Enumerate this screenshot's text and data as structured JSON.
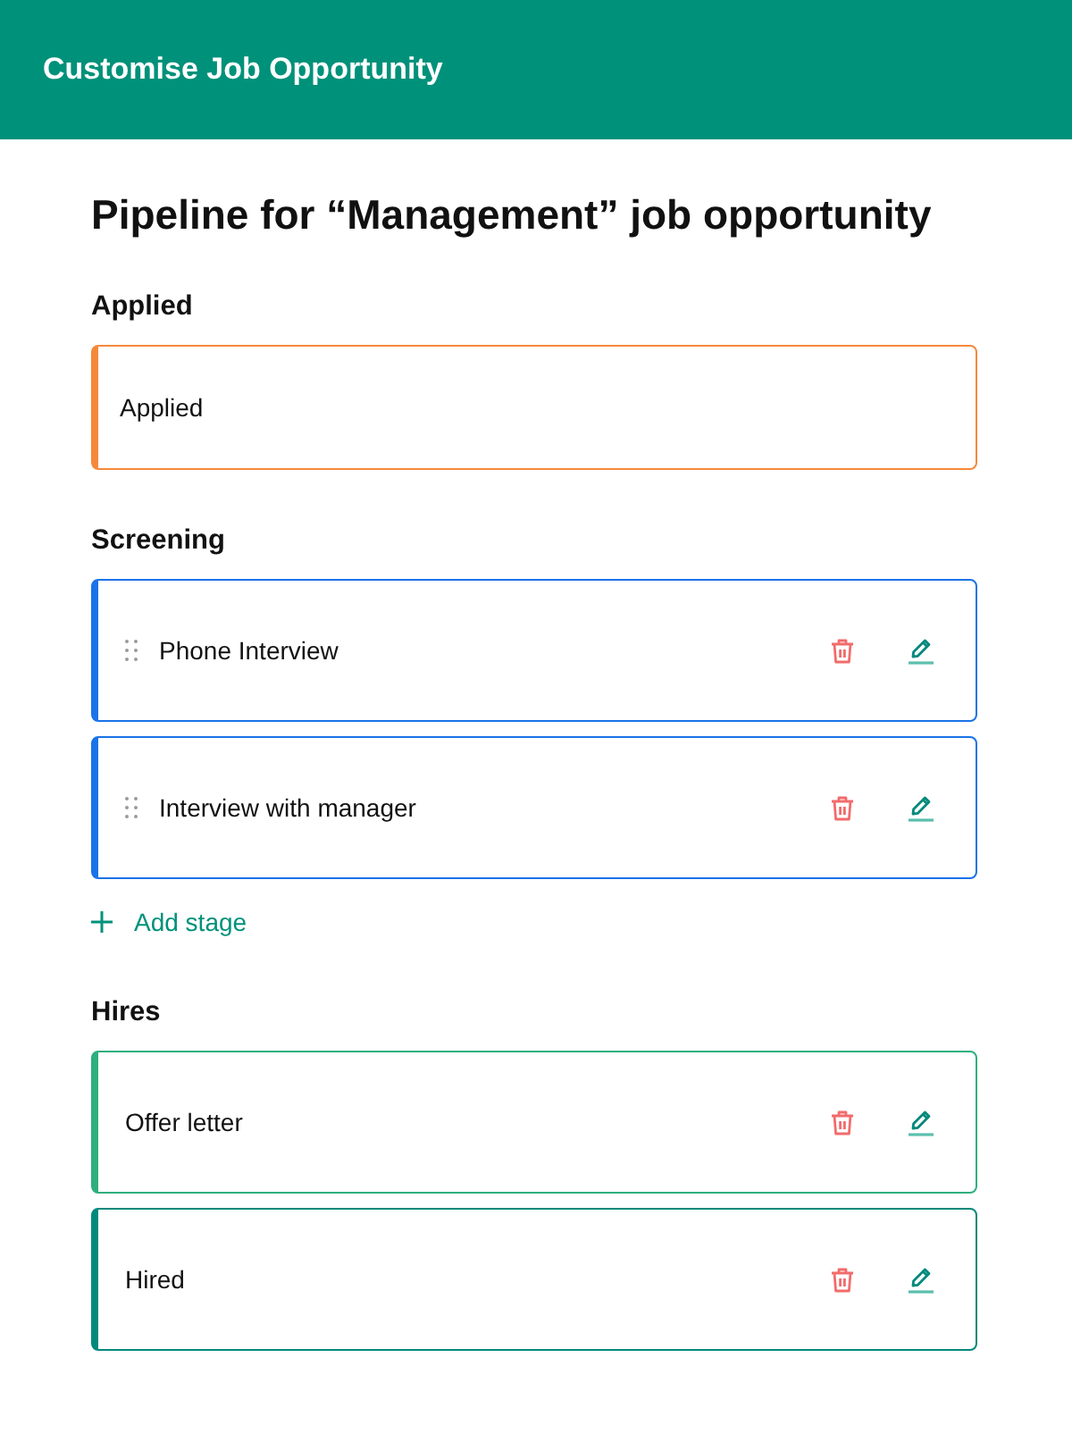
{
  "header": {
    "title": "Customise Job Opportunity"
  },
  "page_title": "Pipeline for “Management” job opportunity",
  "sections": [
    {
      "title": "Applied",
      "stages": [
        {
          "label": "Applied",
          "kind": "fixed",
          "color": "#f5893b"
        }
      ]
    },
    {
      "title": "Screening",
      "stages": [
        {
          "label": "Phone Interview",
          "kind": "sortable",
          "color": "#1a73e8"
        },
        {
          "label": "Interview with manager",
          "kind": "sortable",
          "color": "#1a73e8"
        }
      ],
      "add_button": {
        "label": "Add stage"
      }
    },
    {
      "title": "Hires",
      "stages": [
        {
          "label": "Offer letter",
          "kind": "closing",
          "color": "#2eaf7d"
        },
        {
          "label": "Hired",
          "kind": "closing",
          "color": "#00897b"
        }
      ]
    }
  ]
}
